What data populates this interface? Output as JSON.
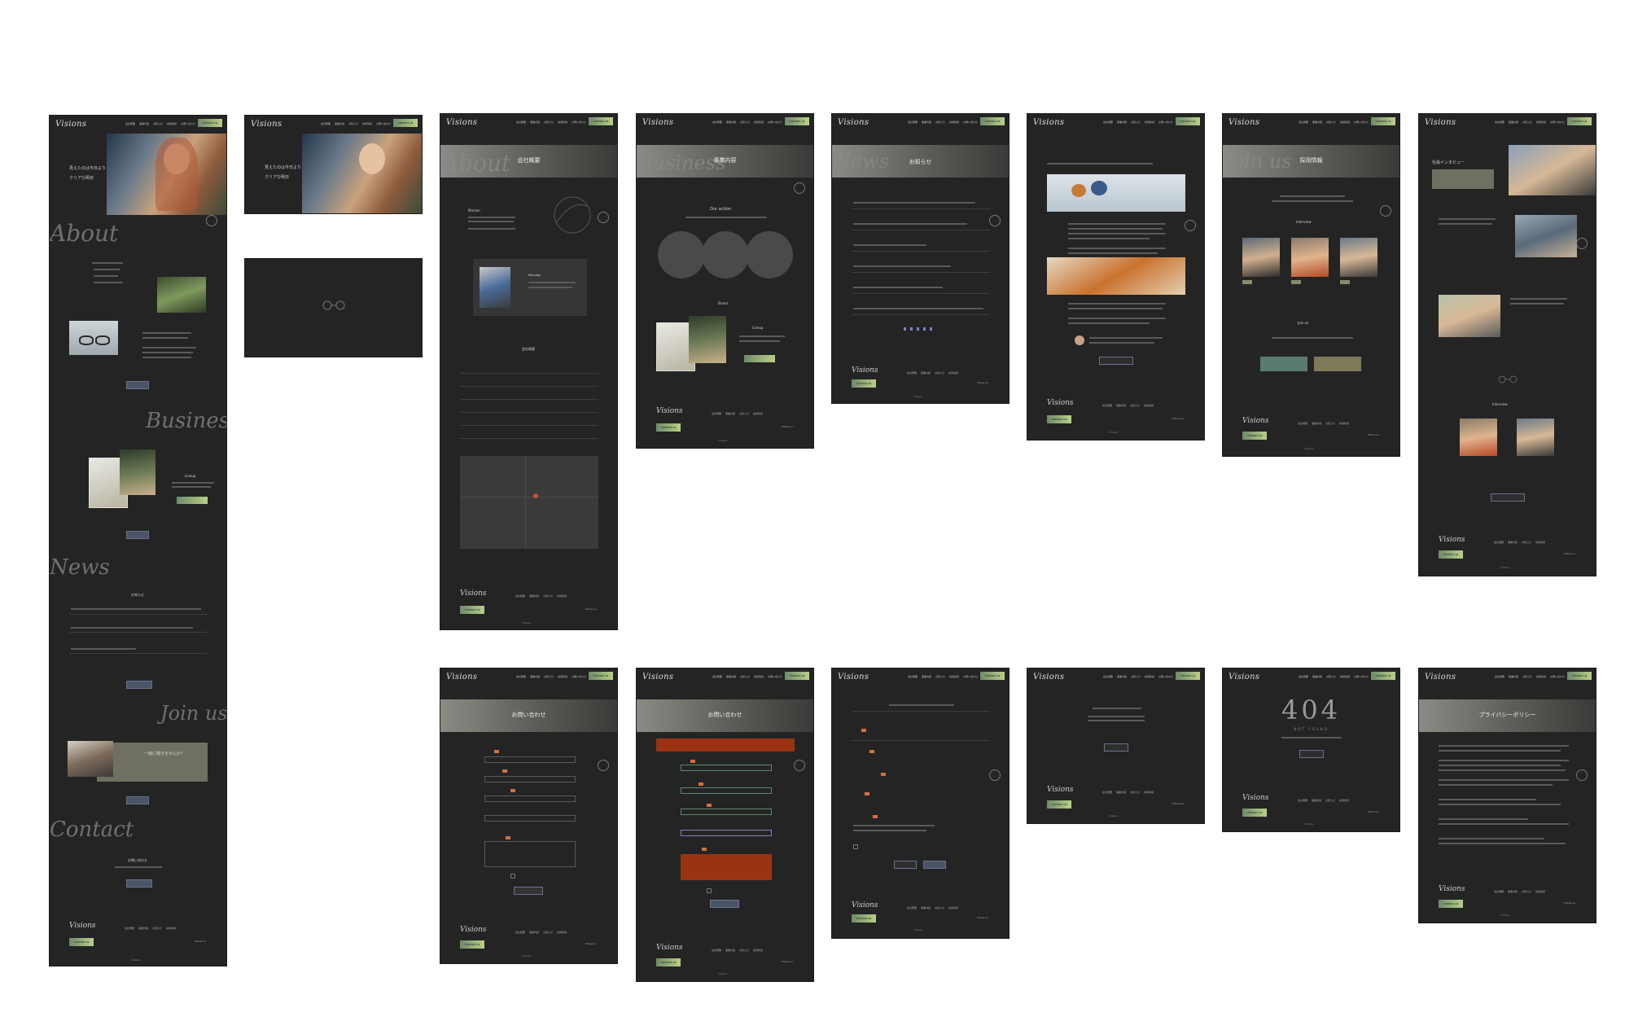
{
  "brand": {
    "logo": "Visions",
    "contact_button": "Contact us"
  },
  "nav_items": [
    "会社概要",
    "事業内容",
    "お知らせ",
    "採用情報",
    "お問い合わせ"
  ],
  "footer": {
    "follow": "Follow us",
    "copyright": "©Visions"
  },
  "top_page": {
    "hero_copy_1": "見えたのは今日より",
    "hero_copy_2": "クリアな明日",
    "about_script": "About",
    "business_script": "Business",
    "news_script": "News",
    "joinus_script": "Join us",
    "contact_script": "Contact",
    "news_heading": "お知らせ",
    "joinus_copy": "一緒に働きませんか？",
    "contact_heading": "お問い合わせ",
    "lineup_label": "Lineup"
  },
  "company_page": {
    "title": "会社概要",
    "script": "About",
    "mission": "Mission",
    "message": "Message",
    "profile_heading": "会社概要"
  },
  "business_page": {
    "title": "事業内容",
    "script": "Business",
    "our_action": "Our action",
    "brand": "Brand",
    "lineup": "Lineup"
  },
  "news_page": {
    "title": "お知らせ",
    "script": "News"
  },
  "recruit_page": {
    "title": "採用情報",
    "script": "Join us",
    "interview": "Interview",
    "join_us": "Join us"
  },
  "interview_page": {
    "title": "社員インタビュー",
    "interview": "Interview"
  },
  "contact_page": {
    "title": "お問い合わせ"
  },
  "error_page": {
    "code": "404",
    "sub": "NOT FOUND"
  },
  "privacy_page": {
    "title": "プライバシーポリシー"
  }
}
